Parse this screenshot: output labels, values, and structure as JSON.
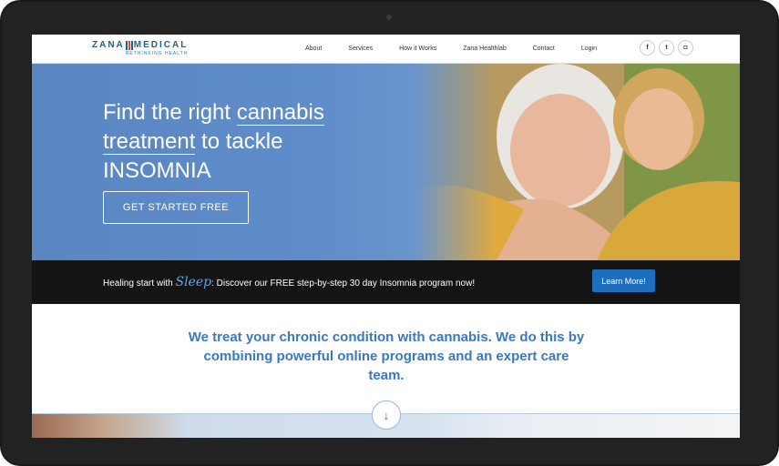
{
  "logo": {
    "name": "ZANA MEDICAL",
    "left": "ZANA",
    "right": "MEDICAL",
    "tagline": "RETHINKING HEALTH"
  },
  "nav": {
    "items": [
      "About",
      "Services",
      "How it Works",
      "Zana Healthlab",
      "Contact",
      "Login"
    ]
  },
  "social": [
    {
      "icon": "facebook-icon",
      "glyph": "f"
    },
    {
      "icon": "twitter-icon",
      "glyph": "t"
    },
    {
      "icon": "instagram-icon",
      "glyph": "◘"
    }
  ],
  "hero": {
    "line1": "Find the right ",
    "line1_ul": "cannabis",
    "line2_ul": "treatment",
    "line2": " to tackle",
    "line3": "INSOMNIA",
    "cta": "GET STARTED FREE"
  },
  "banner": {
    "prefix": "Healing start with ",
    "script": "Sleep",
    "suffix": ": Discover our FREE step-by-step 30 day Insomnia program now!",
    "button": "Learn More!"
  },
  "intro": {
    "text": "We treat your chronic condition with cannabis. We do this by combining powerful online programs and an expert care team."
  },
  "colors": {
    "accent": "#3a78c0",
    "button": "#1e6ec0",
    "banner_bg": "#141414"
  }
}
